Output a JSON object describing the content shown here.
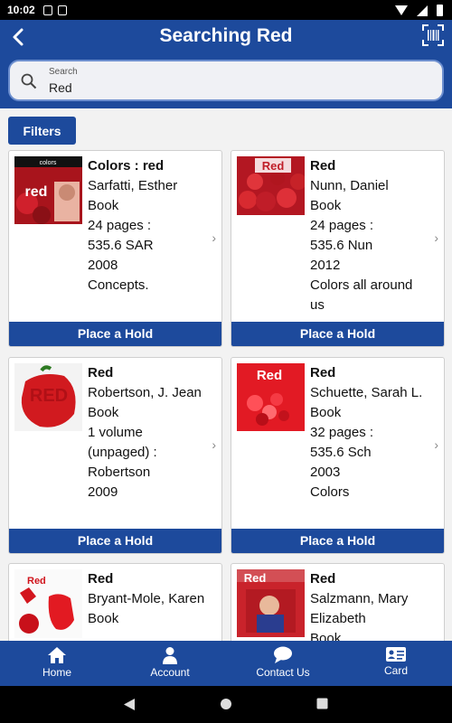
{
  "status_bar": {
    "time": "10:02"
  },
  "header": {
    "title": "Searching Red",
    "search": {
      "label": "Search",
      "value": "Red"
    }
  },
  "filters_label": "Filters",
  "results": [
    {
      "title": "Colors : red",
      "author": "Sarfatti, Esther",
      "format": "Book",
      "pages": "24 pages :",
      "call": "535.6 SAR",
      "year": "2008",
      "extra": "Concepts.",
      "hold": "Place a Hold"
    },
    {
      "title": "Red",
      "author": "Nunn, Daniel",
      "format": "Book",
      "pages": "24 pages :",
      "call": "535.6 Nun",
      "year": "2012",
      "extra": "Colors all around us",
      "hold": "Place a Hold"
    },
    {
      "title": "Red",
      "author": "Robertson, J. Jean",
      "format": "Book",
      "pages": "1 volume (unpaged) :",
      "call": "Robertson",
      "year": "2009",
      "extra": "",
      "hold": "Place a Hold"
    },
    {
      "title": "Red",
      "author": "Schuette, Sarah L.",
      "format": "Book",
      "pages": "32 pages :",
      "call": "535.6 Sch",
      "year": "2003",
      "extra": "Colors",
      "hold": "Place a Hold"
    },
    {
      "title": "Red",
      "author": "Bryant-Mole, Karen",
      "format": "Book"
    },
    {
      "title": "Red",
      "author": "Salzmann, Mary Elizabeth",
      "format": "Book"
    }
  ],
  "covers": {
    "c0": {
      "small": "colors",
      "big": "red"
    },
    "c1": {
      "big": "Red"
    },
    "c2": {
      "big": "RED"
    },
    "c3": {
      "big": "Red"
    },
    "c4": {
      "big": "Red"
    },
    "c5": {
      "big": "Red"
    }
  },
  "bottom_nav": [
    {
      "label": "Home",
      "icon": "home-icon"
    },
    {
      "label": "Account",
      "icon": "account-icon"
    },
    {
      "label": "Contact Us",
      "icon": "chat-icon"
    },
    {
      "label": "Card",
      "icon": "card-icon"
    }
  ],
  "colors": {
    "primary": "#1d4a9c",
    "background": "#f2f2f2",
    "card": "#ffffff"
  }
}
